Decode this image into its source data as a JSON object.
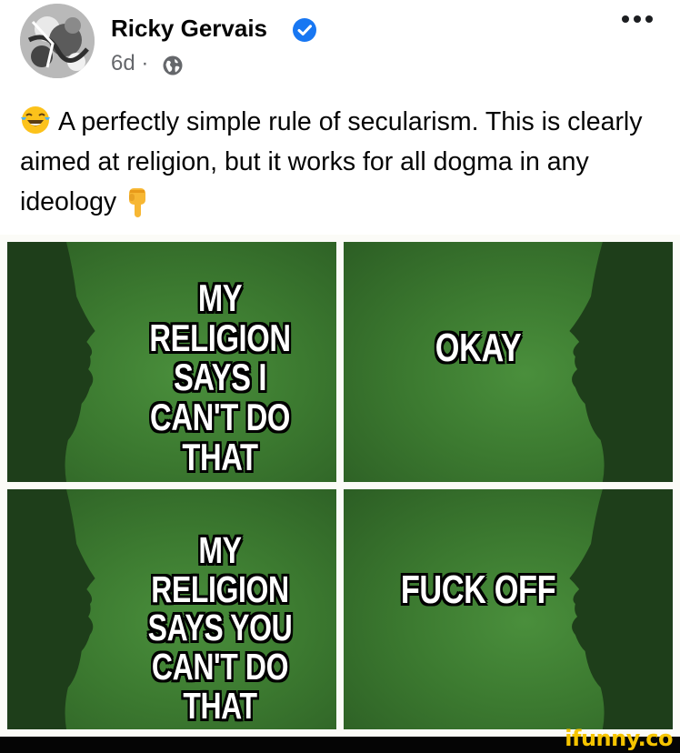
{
  "post": {
    "author": "Ricky Gervais",
    "time": "6d",
    "separator": "·",
    "caption": "A perfectly simple rule of secularism. This is clearly aimed at religion, but it works for all dogma in any ideology",
    "icons": {
      "verified": "verified-badge-icon",
      "audience": "globe-icon",
      "more": "more-options-icon",
      "emoji_start": "laughing-tears-emoji",
      "emoji_end": "pointing-down-emoji"
    },
    "colors": {
      "verified_blue": "#1877f2",
      "meta_gray": "#65676b"
    }
  },
  "meme": {
    "panels": [
      {
        "text": "MY RELIGION SAYS I CAN'T DO THAT"
      },
      {
        "text": "OKAY"
      },
      {
        "text": "MY RELIGION SAYS YOU CAN'T DO THAT"
      },
      {
        "text": "FUCK OFF"
      }
    ],
    "colors": {
      "panel_green": "#3c7a30",
      "silhouette": "#1e3e1a",
      "divider": "#fbfbf7"
    }
  },
  "watermark": "ifunny.co"
}
